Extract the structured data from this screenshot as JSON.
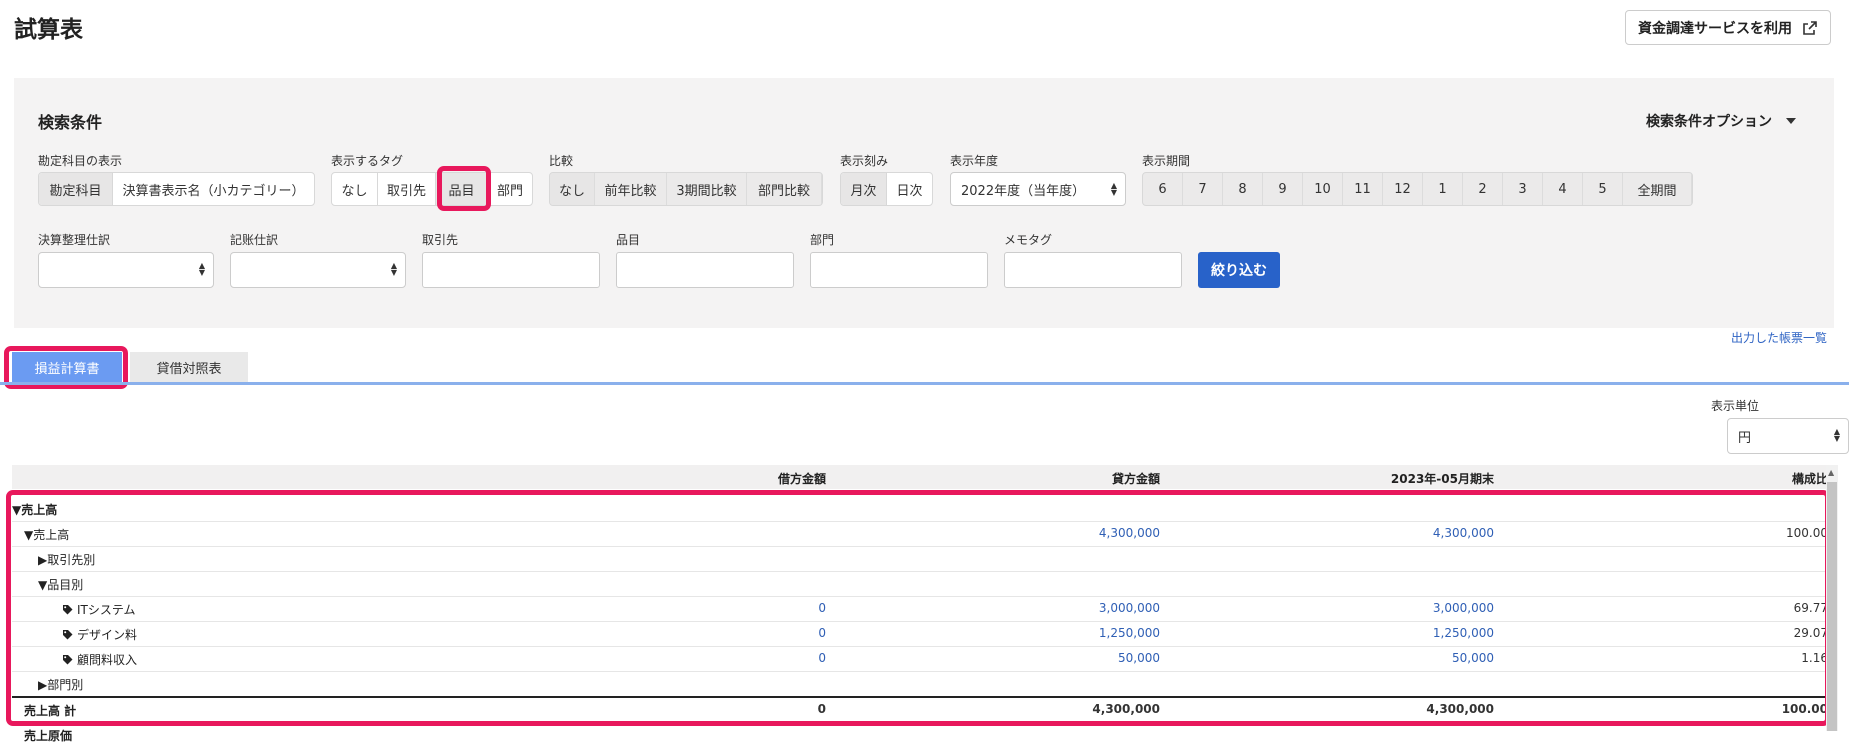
{
  "header": {
    "title": "試算表",
    "external_button": "資金調達サービスを利用"
  },
  "search": {
    "title": "検索条件",
    "options_toggle": "検索条件オプション",
    "account_display": {
      "label": "勘定科目の表示",
      "options": [
        "勘定科目",
        "決算書表示名（小カテゴリー）"
      ]
    },
    "tags": {
      "label": "表示するタグ",
      "options": [
        "なし",
        "取引先",
        "品目",
        "部門"
      ]
    },
    "compare": {
      "label": "比較",
      "options": [
        "なし",
        "前年比較",
        "3期間比較",
        "部門比較"
      ]
    },
    "granularity": {
      "label": "表示刻み",
      "options": [
        "月次",
        "日次"
      ]
    },
    "fiscal_year": {
      "label": "表示年度",
      "value": "2022年度（当年度）"
    },
    "period": {
      "label": "表示期間",
      "options": [
        "6",
        "7",
        "8",
        "9",
        "10",
        "11",
        "12",
        "1",
        "2",
        "3",
        "4",
        "5",
        "全期間"
      ]
    },
    "filters": {
      "closing_entries": "決算整理仕訳",
      "memo_entries": "記账仕訳",
      "partner": "取引先",
      "item": "品目",
      "department": "部門",
      "memo_tag": "メモタグ"
    },
    "submit": "絞り込む"
  },
  "output_link": "出力した帳票一覧",
  "tabs": [
    "損益計算書",
    "貸借対照表"
  ],
  "unit": {
    "label": "表示単位",
    "value": "円"
  },
  "table": {
    "headers": [
      "借方金額",
      "貸方金額",
      "2023年-05月期末",
      "構成比"
    ],
    "rows": [
      {
        "label": "▼売上高",
        "values": [
          "",
          "",
          "",
          ""
        ]
      },
      {
        "label": "▼売上高",
        "values": [
          "",
          "4,300,000",
          "4,300,000",
          "100.00"
        ]
      },
      {
        "label": "▶取引先別",
        "values": [
          "",
          "",
          "",
          ""
        ]
      },
      {
        "label": "▼品目別",
        "values": [
          "",
          "",
          "",
          ""
        ]
      },
      {
        "label": "ITシステム",
        "values": [
          "0",
          "3,000,000",
          "3,000,000",
          "69.77"
        ]
      },
      {
        "label": "デザイン料",
        "values": [
          "0",
          "1,250,000",
          "1,250,000",
          "29.07"
        ]
      },
      {
        "label": "顧問料収入",
        "values": [
          "0",
          "50,000",
          "50,000",
          "1.16"
        ]
      },
      {
        "label": "▶部門別",
        "values": [
          "",
          "",
          "",
          ""
        ]
      },
      {
        "label": "売上高 計",
        "values": [
          "0",
          "4,300,000",
          "4,300,000",
          "100.00"
        ]
      },
      {
        "label": "売上原価",
        "values": [
          "",
          "",
          "",
          ""
        ]
      }
    ]
  },
  "colors": {
    "primary": "#2862c9",
    "highlight": "#e8185c",
    "active_tab": "#6b9bf2",
    "link": "#2f64c4"
  }
}
